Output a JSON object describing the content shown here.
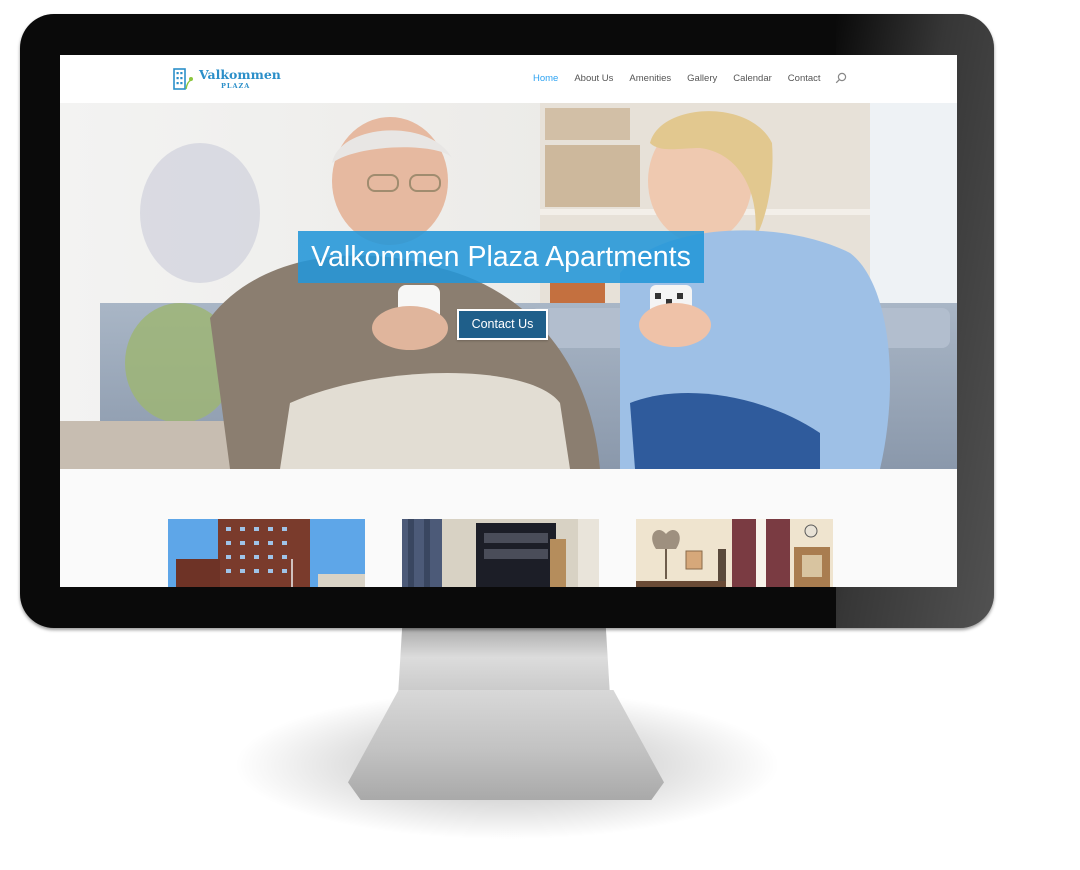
{
  "site": {
    "logo": {
      "name": "Valkommen",
      "sub": "PLAZA"
    },
    "nav": {
      "items": [
        {
          "label": "Home",
          "active": true
        },
        {
          "label": "About Us"
        },
        {
          "label": "Amenities"
        },
        {
          "label": "Gallery"
        },
        {
          "label": "Calendar"
        },
        {
          "label": "Contact"
        }
      ]
    },
    "hero": {
      "title": "Valkommen Plaza Apartments",
      "button_label": "Contact Us"
    }
  },
  "colors": {
    "accent": "#2ea3f2",
    "title_band": "#2396d8",
    "button": "#1f5f8a"
  }
}
